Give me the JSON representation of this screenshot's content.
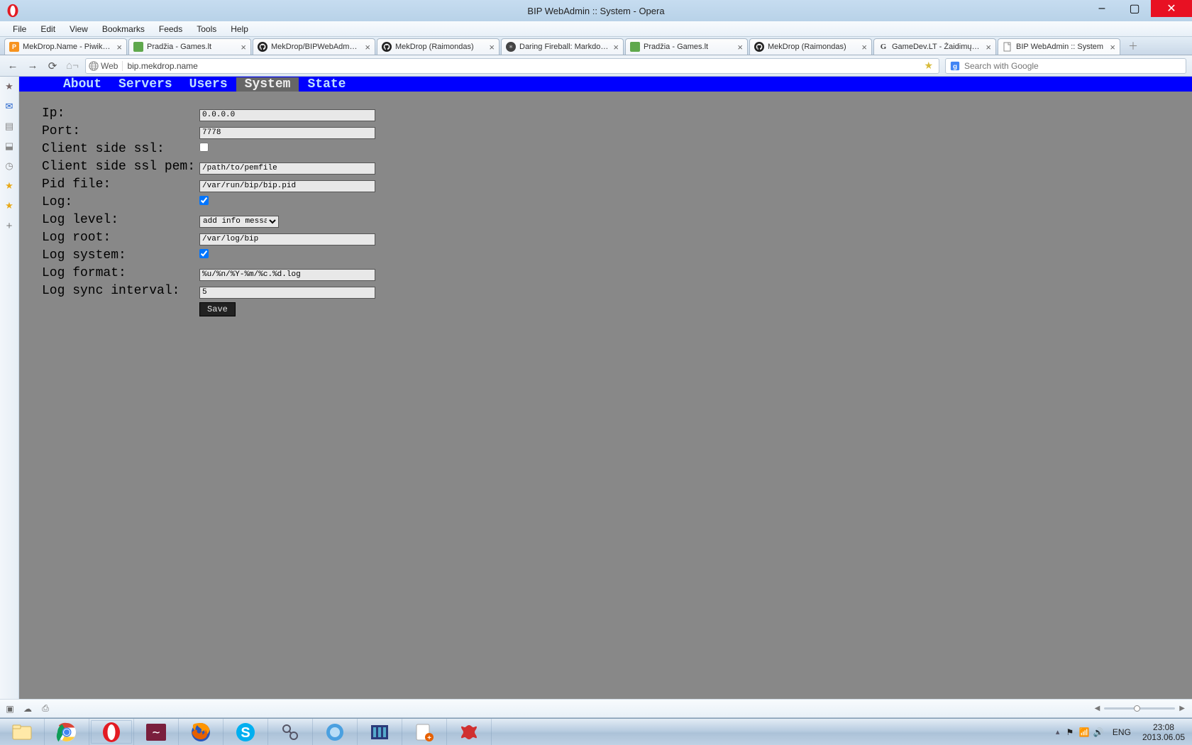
{
  "window": {
    "title": "BIP WebAdmin :: System - Opera"
  },
  "menubar": [
    "File",
    "Edit",
    "View",
    "Bookmarks",
    "Feeds",
    "Tools",
    "Help"
  ],
  "tabs": [
    {
      "title": "MekDrop.Name - Piwik…",
      "icon": "piwik"
    },
    {
      "title": "Pradžia - Games.lt",
      "icon": "games"
    },
    {
      "title": "MekDrop/BIPWebAdm…",
      "icon": "github"
    },
    {
      "title": "MekDrop (Raimondas)",
      "icon": "github"
    },
    {
      "title": "Daring Fireball: Markdo…",
      "icon": "df"
    },
    {
      "title": "Pradžia - Games.lt",
      "icon": "games"
    },
    {
      "title": "MekDrop (Raimondas)",
      "icon": "github"
    },
    {
      "title": "GameDev.LT - Žaidimų…",
      "icon": "gdev"
    },
    {
      "title": "BIP WebAdmin :: System",
      "icon": "page",
      "active": true
    }
  ],
  "address": {
    "web_label": "Web",
    "url": "bip.mekdrop.name"
  },
  "search": {
    "placeholder": "Search with Google"
  },
  "page": {
    "nav": [
      {
        "label": "About"
      },
      {
        "label": "Servers"
      },
      {
        "label": "Users"
      },
      {
        "label": "System",
        "active": true
      },
      {
        "label": "State"
      }
    ],
    "form": {
      "ip": {
        "label": "Ip:",
        "value": "0.0.0.0"
      },
      "port": {
        "label": "Port:",
        "value": "7778"
      },
      "client_ssl": {
        "label": "Client side ssl:",
        "checked": false
      },
      "client_ssl_pem": {
        "label": "Client side ssl pem:",
        "value": "/path/to/pemfile"
      },
      "pid_file": {
        "label": "Pid file:",
        "value": "/var/run/bip/bip.pid"
      },
      "log": {
        "label": "Log:",
        "checked": true
      },
      "log_level": {
        "label": "Log level:",
        "value": "add info messages"
      },
      "log_root": {
        "label": "Log root:",
        "value": "/var/log/bip"
      },
      "log_system": {
        "label": "Log system:",
        "checked": true
      },
      "log_format": {
        "label": "Log format:",
        "value": "%u/%n/%Y-%m/%c.%d.log"
      },
      "log_sync": {
        "label": "Log sync interval:",
        "value": "5"
      },
      "save": "Save"
    }
  },
  "tray": {
    "lang": "ENG",
    "time": "23:08",
    "date": "2013.06.05"
  }
}
